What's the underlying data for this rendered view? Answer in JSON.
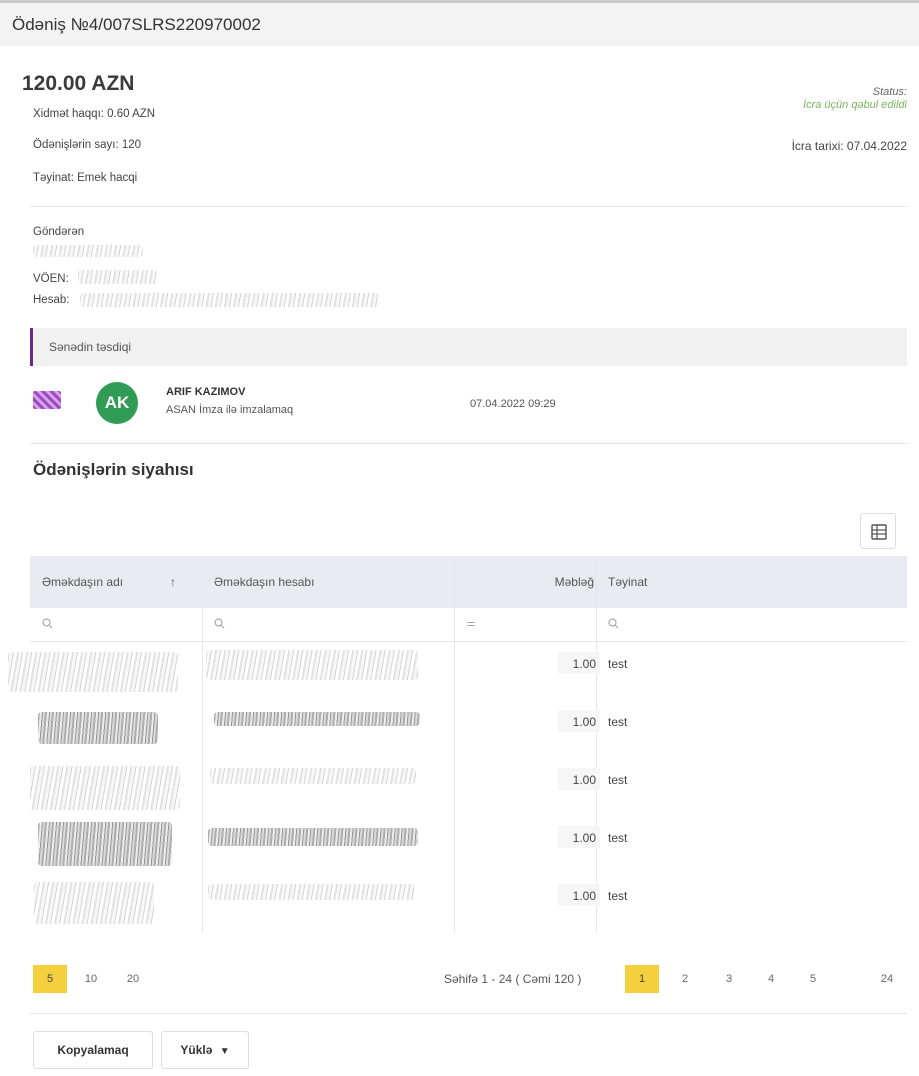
{
  "header": {
    "title": "Ödəniş №4/007SLRS220970002"
  },
  "summary": {
    "amount": "120.00 AZN",
    "service_fee": "Xidmət haqqı: 0.60 AZN",
    "payments_count": "Ödənişlərin sayı: 120",
    "purpose": "Təyinat: Emek hacqi",
    "status_label": "Status:",
    "status_value": "İcra üçün qəbul edildi",
    "exec_date": "İcra tarixi: 07.04.2022",
    "status_color": "#7ab55c"
  },
  "sender": {
    "label": "Göndərən",
    "voen_label": "VÖEN:",
    "account_label": "Hesab:"
  },
  "confirmation": {
    "title": "Sənədin təsdiqi",
    "avatar_initials": "AK",
    "avatar_color": "#2f9b55",
    "signer_name": "ARIF KAZIMOV",
    "method": "ASAN İmza ilə imzalamaq",
    "datetime": "07.04.2022 09:29"
  },
  "list": {
    "title": "Ödənişlərin siyahısı",
    "export_icon": "excel-export-icon",
    "columns": [
      "Əməkdaşın adı",
      "Əməkdaşın hesabı",
      "Məbləğ",
      "Təyinat"
    ],
    "sort_indicator": "↑",
    "rows": [
      {
        "amount": "1.00",
        "purpose": "test"
      },
      {
        "amount": "1.00",
        "purpose": "test"
      },
      {
        "amount": "1.00",
        "purpose": "test"
      },
      {
        "amount": "1.00",
        "purpose": "test"
      },
      {
        "amount": "1.00",
        "purpose": "test"
      }
    ]
  },
  "pagination": {
    "page_sizes": [
      "5",
      "10",
      "20"
    ],
    "info": "Səhifə 1 - 24 ( Cəmi 120 )",
    "pages": [
      "1",
      "2",
      "3",
      "4",
      "5",
      "24"
    ],
    "active_color": "#f4d03f"
  },
  "actions": {
    "copy_label": "Kopyalamaq",
    "download_label": "Yüklə"
  }
}
